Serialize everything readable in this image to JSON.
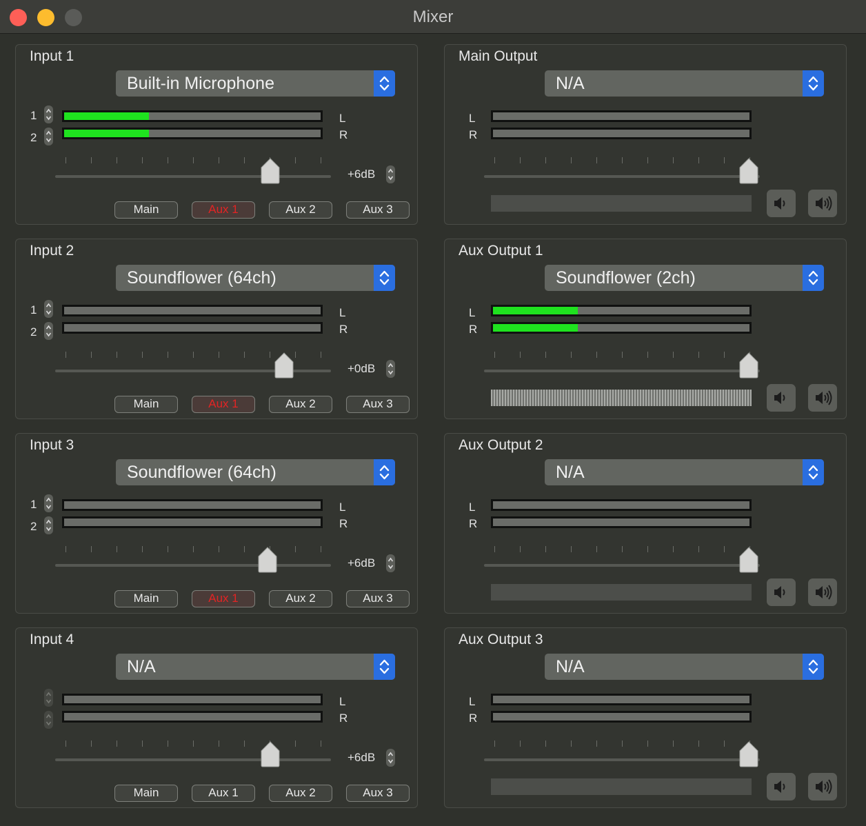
{
  "window": {
    "title": "Mixer"
  },
  "inputs": [
    {
      "title": "Input 1",
      "device": "Built-in Microphone",
      "channels": [
        "1",
        "2"
      ],
      "meter_levels": [
        0.33,
        0.33
      ],
      "gain": "+6dB",
      "fader_level": 0.78,
      "routes": [
        "Main",
        "Aux 1",
        "Aux 2",
        "Aux 3"
      ],
      "active_route": "Aux 1"
    },
    {
      "title": "Input 2",
      "device": "Soundflower (64ch)",
      "channels": [
        "1",
        "2"
      ],
      "meter_levels": [
        0,
        0
      ],
      "gain": "+0dB",
      "fader_level": 0.83,
      "routes": [
        "Main",
        "Aux 1",
        "Aux 2",
        "Aux 3"
      ],
      "active_route": "Aux 1"
    },
    {
      "title": "Input 3",
      "device": "Soundflower (64ch)",
      "channels": [
        "1",
        "2"
      ],
      "meter_levels": [
        0,
        0
      ],
      "gain": "+6dB",
      "fader_level": 0.77,
      "routes": [
        "Main",
        "Aux 1",
        "Aux 2",
        "Aux 3"
      ],
      "active_route": "Aux 1"
    },
    {
      "title": "Input 4",
      "device": "N/A",
      "channels": [
        "",
        ""
      ],
      "meter_levels": [
        0,
        0
      ],
      "gain": "+6dB",
      "fader_level": 0.78,
      "routes": [
        "Main",
        "Aux 1",
        "Aux 2",
        "Aux 3"
      ],
      "active_route": ""
    }
  ],
  "outputs": [
    {
      "title": "Main Output",
      "device": "N/A",
      "meter_levels": [
        0,
        0
      ],
      "fader_level": 0.96,
      "level_active": false
    },
    {
      "title": "Aux Output 1",
      "device": "Soundflower (2ch)",
      "meter_levels": [
        0.33,
        0.33
      ],
      "fader_level": 0.96,
      "level_active": true
    },
    {
      "title": "Aux Output 2",
      "device": "N/A",
      "meter_levels": [
        0,
        0
      ],
      "fader_level": 0.96,
      "level_active": false
    },
    {
      "title": "Aux Output 3",
      "device": "N/A",
      "meter_levels": [
        0,
        0
      ],
      "fader_level": 0.96,
      "level_active": false
    }
  ],
  "labels": {
    "left": "L",
    "right": "R"
  },
  "icons": {
    "stepper": "up-down-chevron-icon",
    "popup": "popup-chevron-icon",
    "volume_low": "speaker-low-icon",
    "volume_high": "speaker-high-icon"
  },
  "colors": {
    "meter_green": "#1fe21f",
    "accent_blue": "#2a6ee0",
    "active_route_red": "#e32424"
  }
}
